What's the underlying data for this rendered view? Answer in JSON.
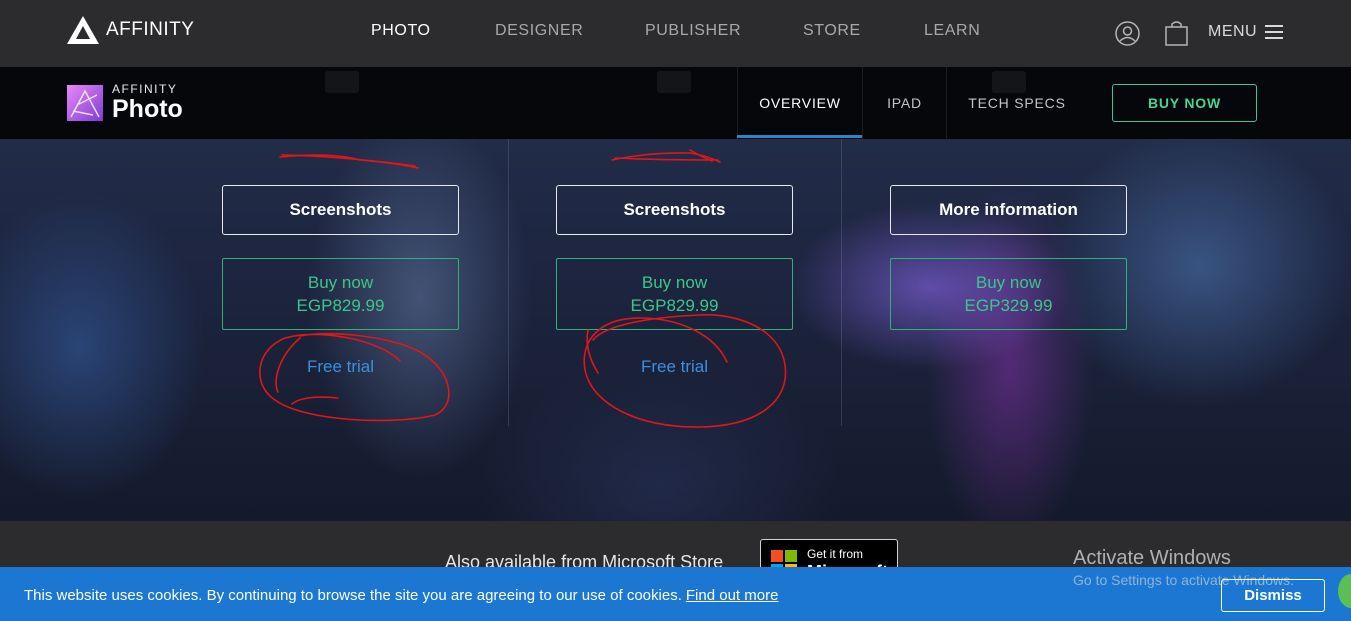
{
  "topnav": {
    "brand": "AFFINITY",
    "links": [
      "PHOTO",
      "DESIGNER",
      "PUBLISHER",
      "STORE",
      "LEARN"
    ],
    "menu": "MENU"
  },
  "subnav": {
    "logo_small": "AFFINITY",
    "logo_big": "Photo",
    "tabs": [
      "OVERVIEW",
      "IPAD",
      "TECH SPECS"
    ],
    "buy_now": "BUY NOW"
  },
  "products": {
    "mac": {
      "screenshots": "Screenshots",
      "buy_l1": "Buy now",
      "price": "EGP829.99",
      "free_trial": "Free trial"
    },
    "windows": {
      "screenshots": "Screenshots",
      "buy_l1": "Buy now",
      "price": "EGP829.99",
      "free_trial": "Free trial"
    },
    "ipad": {
      "more_info": "More information",
      "buy_l1": "Buy now",
      "price": "EGP329.99"
    }
  },
  "bottom": {
    "also": "Also available from Microsoft Store",
    "badge_small": "Get it from",
    "badge_big": "Microsoft",
    "activate_title": "Activate Windows",
    "activate_sub": "Go to Settings to activate Windows."
  },
  "cookie": {
    "text": "This website uses cookies. By continuing to browse the site you are agreeing to our use of cookies.",
    "link": "Find out more",
    "dismiss": "Dismiss"
  },
  "colors": {
    "accent_green": "#3cc78a",
    "link_blue": "#3a8fe0",
    "cookie_blue": "#1b77d2",
    "annotation_red": "#e0161b"
  }
}
